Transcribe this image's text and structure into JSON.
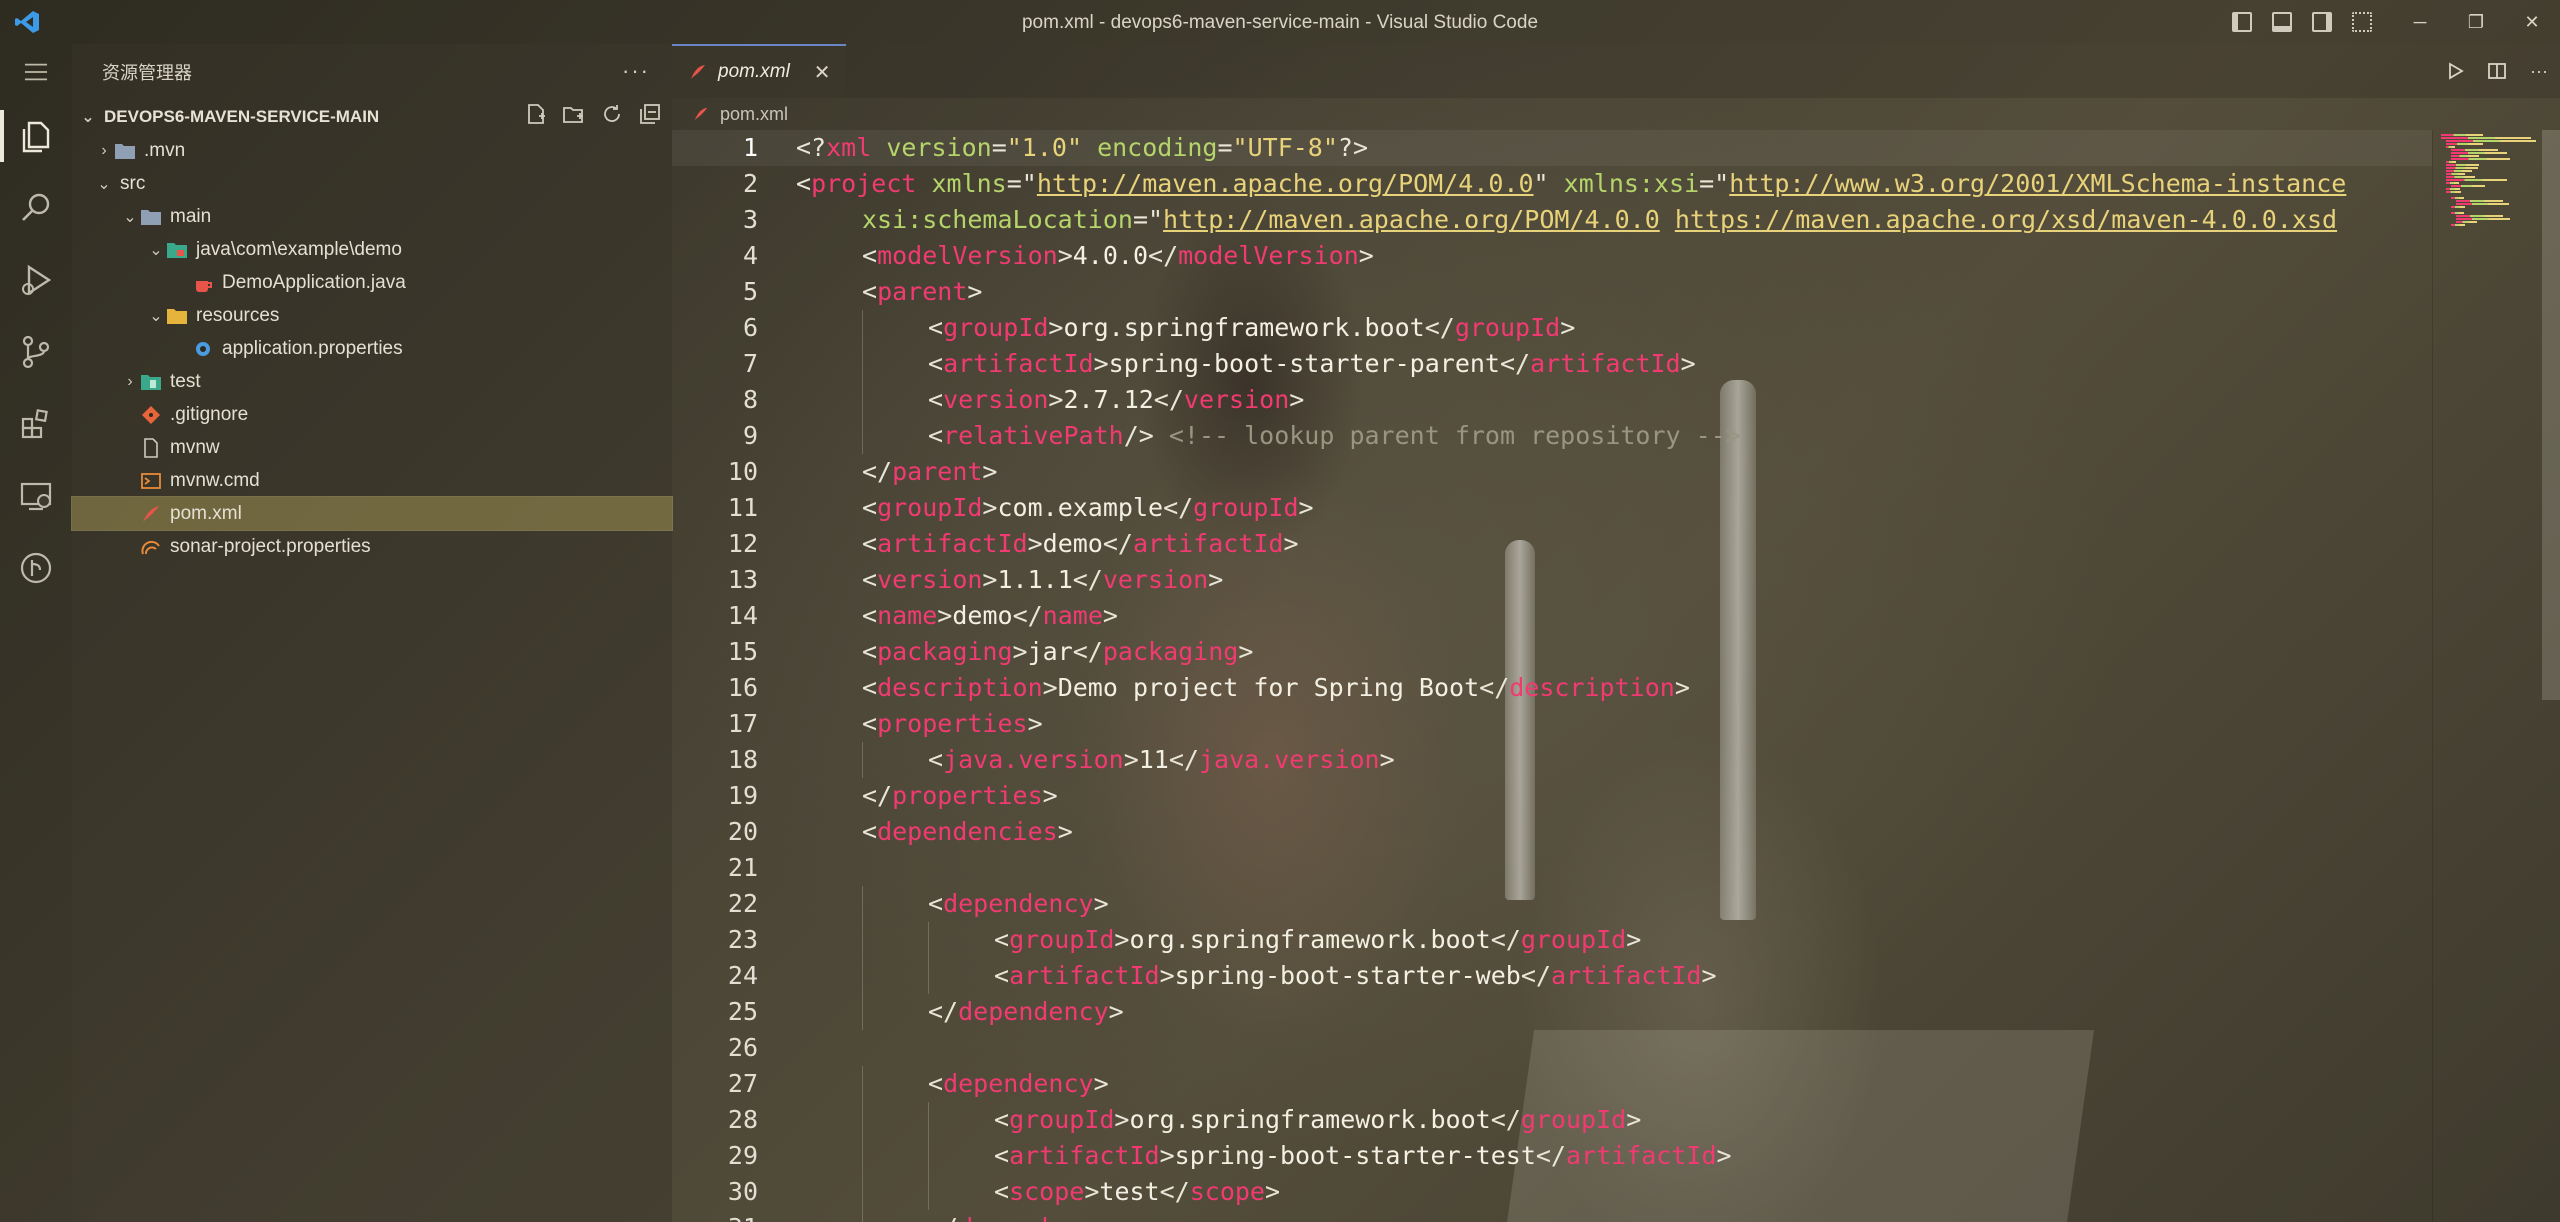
{
  "window": {
    "title": "pom.xml - devops6-maven-service-main - Visual Studio Code",
    "minimize": "─",
    "restore": "❐",
    "close": "✕"
  },
  "activity": {
    "items": [
      "explorer",
      "search",
      "run-and-debug",
      "source-control",
      "extensions",
      "remote-explorer",
      "gitlens"
    ]
  },
  "sidebar": {
    "title": "资源管理器",
    "more": "···",
    "section": "DEVOPS6-MAVEN-SERVICE-MAIN",
    "tree": [
      {
        "label": ".mvn",
        "depth": 0,
        "chevron": "›",
        "icon": "folder"
      },
      {
        "label": "src",
        "depth": 0,
        "chevron": "⌄",
        "icon": "none"
      },
      {
        "label": "main",
        "depth": 1,
        "chevron": "⌄",
        "icon": "folder-open"
      },
      {
        "label": "java\\com\\example\\demo",
        "depth": 2,
        "chevron": "⌄",
        "icon": "folder-java"
      },
      {
        "label": "DemoApplication.java",
        "depth": 3,
        "chevron": "",
        "icon": "java"
      },
      {
        "label": "resources",
        "depth": 2,
        "chevron": "⌄",
        "icon": "folder-resources"
      },
      {
        "label": "application.properties",
        "depth": 3,
        "chevron": "",
        "icon": "gear"
      },
      {
        "label": "test",
        "depth": 1,
        "chevron": "›",
        "icon": "folder-test"
      },
      {
        "label": ".gitignore",
        "depth": 1,
        "chevron": "",
        "icon": "git"
      },
      {
        "label": "mvnw",
        "depth": 1,
        "chevron": "",
        "icon": "file"
      },
      {
        "label": "mvnw.cmd",
        "depth": 1,
        "chevron": "",
        "icon": "terminal"
      },
      {
        "label": "pom.xml",
        "depth": 1,
        "chevron": "",
        "icon": "xml",
        "selected": true
      },
      {
        "label": "sonar-project.properties",
        "depth": 1,
        "chevron": "",
        "icon": "sonar"
      }
    ]
  },
  "editor": {
    "tab": {
      "label": "pom.xml",
      "close": "✕"
    },
    "breadcrumb": "pom.xml",
    "lines": [
      {
        "n": "1",
        "indent": 0,
        "t": [
          [
            "p",
            "<?"
          ],
          [
            "x",
            "xml"
          ],
          [
            "a",
            " version"
          ],
          [
            "p",
            "="
          ],
          [
            "s",
            "\"1.0\""
          ],
          [
            "a",
            " encoding"
          ],
          [
            "p",
            "="
          ],
          [
            "s",
            "\"UTF-8\""
          ],
          [
            "p",
            "?>"
          ]
        ]
      },
      {
        "n": "2",
        "indent": 0,
        "t": [
          [
            "p",
            "<"
          ],
          [
            "g",
            "project"
          ],
          [
            "a",
            " xmlns"
          ],
          [
            "p",
            "=\""
          ],
          [
            "u",
            "http://maven.apache.org/POM/4.0.0"
          ],
          [
            "p",
            "\""
          ],
          [
            "a",
            " xmlns:xsi"
          ],
          [
            "p",
            "=\""
          ],
          [
            "u",
            "http://www.w3.org/2001/XMLSchema-instance"
          ]
        ]
      },
      {
        "n": "3",
        "indent": 1,
        "t": [
          [
            "a",
            "xsi:schemaLocation"
          ],
          [
            "p",
            "=\""
          ],
          [
            "u",
            "http://maven.apache.org/POM/4.0.0"
          ],
          [
            "p",
            " "
          ],
          [
            "u",
            "https://maven.apache.org/xsd/maven-4.0.0.xsd"
          ]
        ]
      },
      {
        "n": "4",
        "indent": 1,
        "t": [
          [
            "p",
            "<"
          ],
          [
            "g",
            "modelVersion"
          ],
          [
            "p",
            ">"
          ],
          [
            "v",
            "4.0.0"
          ],
          [
            "p",
            "</"
          ],
          [
            "g",
            "modelVersion"
          ],
          [
            "p",
            ">"
          ]
        ]
      },
      {
        "n": "5",
        "indent": 1,
        "t": [
          [
            "p",
            "<"
          ],
          [
            "g",
            "parent"
          ],
          [
            "p",
            ">"
          ]
        ]
      },
      {
        "n": "6",
        "indent": 2,
        "t": [
          [
            "p",
            "<"
          ],
          [
            "g",
            "groupId"
          ],
          [
            "p",
            ">"
          ],
          [
            "v",
            "org.springframework.boot"
          ],
          [
            "p",
            "</"
          ],
          [
            "g",
            "groupId"
          ],
          [
            "p",
            ">"
          ]
        ]
      },
      {
        "n": "7",
        "indent": 2,
        "t": [
          [
            "p",
            "<"
          ],
          [
            "g",
            "artifactId"
          ],
          [
            "p",
            ">"
          ],
          [
            "v",
            "spring-boot-starter-parent"
          ],
          [
            "p",
            "</"
          ],
          [
            "g",
            "artifactId"
          ],
          [
            "p",
            ">"
          ]
        ]
      },
      {
        "n": "8",
        "indent": 2,
        "t": [
          [
            "p",
            "<"
          ],
          [
            "g",
            "version"
          ],
          [
            "p",
            ">"
          ],
          [
            "v",
            "2.7.12"
          ],
          [
            "p",
            "</"
          ],
          [
            "g",
            "version"
          ],
          [
            "p",
            ">"
          ]
        ]
      },
      {
        "n": "9",
        "indent": 2,
        "t": [
          [
            "p",
            "<"
          ],
          [
            "g",
            "relativePath"
          ],
          [
            "p",
            "/> "
          ],
          [
            "c",
            "<!-- lookup parent from repository -->"
          ]
        ]
      },
      {
        "n": "10",
        "indent": 1,
        "t": [
          [
            "p",
            "</"
          ],
          [
            "g",
            "parent"
          ],
          [
            "p",
            ">"
          ]
        ]
      },
      {
        "n": "11",
        "indent": 1,
        "t": [
          [
            "p",
            "<"
          ],
          [
            "g",
            "groupId"
          ],
          [
            "p",
            ">"
          ],
          [
            "v",
            "com.example"
          ],
          [
            "p",
            "</"
          ],
          [
            "g",
            "groupId"
          ],
          [
            "p",
            ">"
          ]
        ]
      },
      {
        "n": "12",
        "indent": 1,
        "t": [
          [
            "p",
            "<"
          ],
          [
            "g",
            "artifactId"
          ],
          [
            "p",
            ">"
          ],
          [
            "v",
            "demo"
          ],
          [
            "p",
            "</"
          ],
          [
            "g",
            "artifactId"
          ],
          [
            "p",
            ">"
          ]
        ]
      },
      {
        "n": "13",
        "indent": 1,
        "t": [
          [
            "p",
            "<"
          ],
          [
            "g",
            "version"
          ],
          [
            "p",
            ">"
          ],
          [
            "v",
            "1.1.1"
          ],
          [
            "p",
            "</"
          ],
          [
            "g",
            "version"
          ],
          [
            "p",
            ">"
          ]
        ]
      },
      {
        "n": "14",
        "indent": 1,
        "t": [
          [
            "p",
            "<"
          ],
          [
            "g",
            "name"
          ],
          [
            "p",
            ">"
          ],
          [
            "v",
            "demo"
          ],
          [
            "p",
            "</"
          ],
          [
            "g",
            "name"
          ],
          [
            "p",
            ">"
          ]
        ]
      },
      {
        "n": "15",
        "indent": 1,
        "t": [
          [
            "p",
            "<"
          ],
          [
            "g",
            "packaging"
          ],
          [
            "p",
            ">"
          ],
          [
            "v",
            "jar"
          ],
          [
            "p",
            "</"
          ],
          [
            "g",
            "packaging"
          ],
          [
            "p",
            ">"
          ]
        ]
      },
      {
        "n": "16",
        "indent": 1,
        "t": [
          [
            "p",
            "<"
          ],
          [
            "g",
            "description"
          ],
          [
            "p",
            ">"
          ],
          [
            "v",
            "Demo project for Spring Boot"
          ],
          [
            "p",
            "</"
          ],
          [
            "g",
            "description"
          ],
          [
            "p",
            ">"
          ]
        ]
      },
      {
        "n": "17",
        "indent": 1,
        "t": [
          [
            "p",
            "<"
          ],
          [
            "g",
            "properties"
          ],
          [
            "p",
            ">"
          ]
        ]
      },
      {
        "n": "18",
        "indent": 2,
        "t": [
          [
            "p",
            "<"
          ],
          [
            "g",
            "java.version"
          ],
          [
            "p",
            ">"
          ],
          [
            "v",
            "11"
          ],
          [
            "p",
            "</"
          ],
          [
            "g",
            "java.version"
          ],
          [
            "p",
            ">"
          ]
        ]
      },
      {
        "n": "19",
        "indent": 1,
        "t": [
          [
            "p",
            "</"
          ],
          [
            "g",
            "properties"
          ],
          [
            "p",
            ">"
          ]
        ]
      },
      {
        "n": "20",
        "indent": 1,
        "t": [
          [
            "p",
            "<"
          ],
          [
            "g",
            "dependencies"
          ],
          [
            "p",
            ">"
          ]
        ]
      },
      {
        "n": "21",
        "indent": 0,
        "t": []
      },
      {
        "n": "22",
        "indent": 2,
        "t": [
          [
            "p",
            "<"
          ],
          [
            "g",
            "dependency"
          ],
          [
            "p",
            ">"
          ]
        ]
      },
      {
        "n": "23",
        "indent": 3,
        "t": [
          [
            "p",
            "<"
          ],
          [
            "g",
            "groupId"
          ],
          [
            "p",
            ">"
          ],
          [
            "v",
            "org.springframework.boot"
          ],
          [
            "p",
            "</"
          ],
          [
            "g",
            "groupId"
          ],
          [
            "p",
            ">"
          ]
        ]
      },
      {
        "n": "24",
        "indent": 3,
        "t": [
          [
            "p",
            "<"
          ],
          [
            "g",
            "artifactId"
          ],
          [
            "p",
            ">"
          ],
          [
            "v",
            "spring-boot-starter-web"
          ],
          [
            "p",
            "</"
          ],
          [
            "g",
            "artifactId"
          ],
          [
            "p",
            ">"
          ]
        ]
      },
      {
        "n": "25",
        "indent": 2,
        "t": [
          [
            "p",
            "</"
          ],
          [
            "g",
            "dependency"
          ],
          [
            "p",
            ">"
          ]
        ]
      },
      {
        "n": "26",
        "indent": 0,
        "t": []
      },
      {
        "n": "27",
        "indent": 2,
        "t": [
          [
            "p",
            "<"
          ],
          [
            "g",
            "dependency"
          ],
          [
            "p",
            ">"
          ]
        ]
      },
      {
        "n": "28",
        "indent": 3,
        "t": [
          [
            "p",
            "<"
          ],
          [
            "g",
            "groupId"
          ],
          [
            "p",
            ">"
          ],
          [
            "v",
            "org.springframework.boot"
          ],
          [
            "p",
            "</"
          ],
          [
            "g",
            "groupId"
          ],
          [
            "p",
            ">"
          ]
        ]
      },
      {
        "n": "29",
        "indent": 3,
        "t": [
          [
            "p",
            "<"
          ],
          [
            "g",
            "artifactId"
          ],
          [
            "p",
            ">"
          ],
          [
            "v",
            "spring-boot-starter-test"
          ],
          [
            "p",
            "</"
          ],
          [
            "g",
            "artifactId"
          ],
          [
            "p",
            ">"
          ]
        ]
      },
      {
        "n": "30",
        "indent": 3,
        "t": [
          [
            "p",
            "<"
          ],
          [
            "g",
            "scope"
          ],
          [
            "p",
            ">"
          ],
          [
            "v",
            "test"
          ],
          [
            "p",
            "</"
          ],
          [
            "g",
            "scope"
          ],
          [
            "p",
            ">"
          ]
        ]
      },
      {
        "n": "31",
        "indent": 2,
        "t": [
          [
            "p",
            "</"
          ],
          [
            "g",
            "dependency"
          ],
          [
            "p",
            ">"
          ]
        ]
      }
    ]
  },
  "colors": {
    "tag": "#f23a72",
    "attr": "#b5d46a",
    "string": "#e8d27a",
    "comment": "#9a9582",
    "selection": "#b4a55a",
    "accent": "#6a86c8"
  }
}
